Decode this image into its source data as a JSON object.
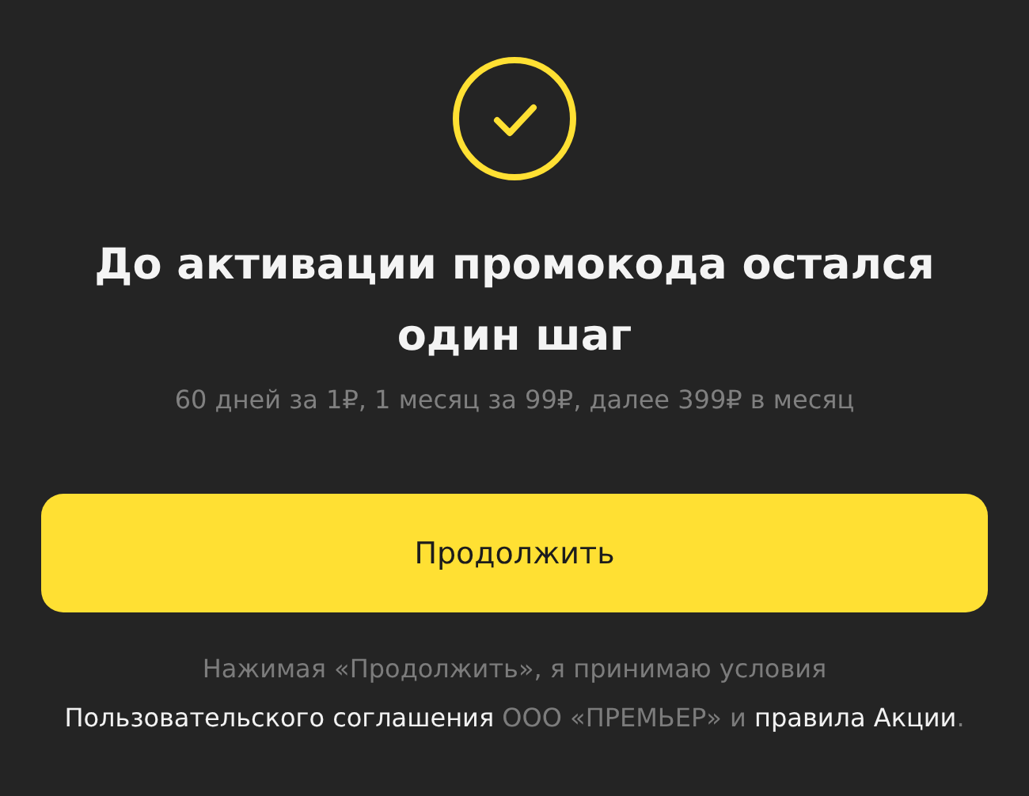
{
  "title": "До активации промокода остался один шаг",
  "subtitle": "60 дней за 1₽, 1 месяц за 99₽, далее 399₽ в месяц",
  "button": "Продолжить",
  "legal": [
    {
      "kind": "text",
      "text": "Нажимая «Продолжить», я принимаю условия "
    },
    {
      "kind": "link",
      "text": "Пользовательского соглашения"
    },
    {
      "kind": "text",
      "text": " ООО «ПРЕМЬЕР» и "
    },
    {
      "kind": "link",
      "text": "правила Акции"
    },
    {
      "kind": "text",
      "text": "."
    }
  ]
}
